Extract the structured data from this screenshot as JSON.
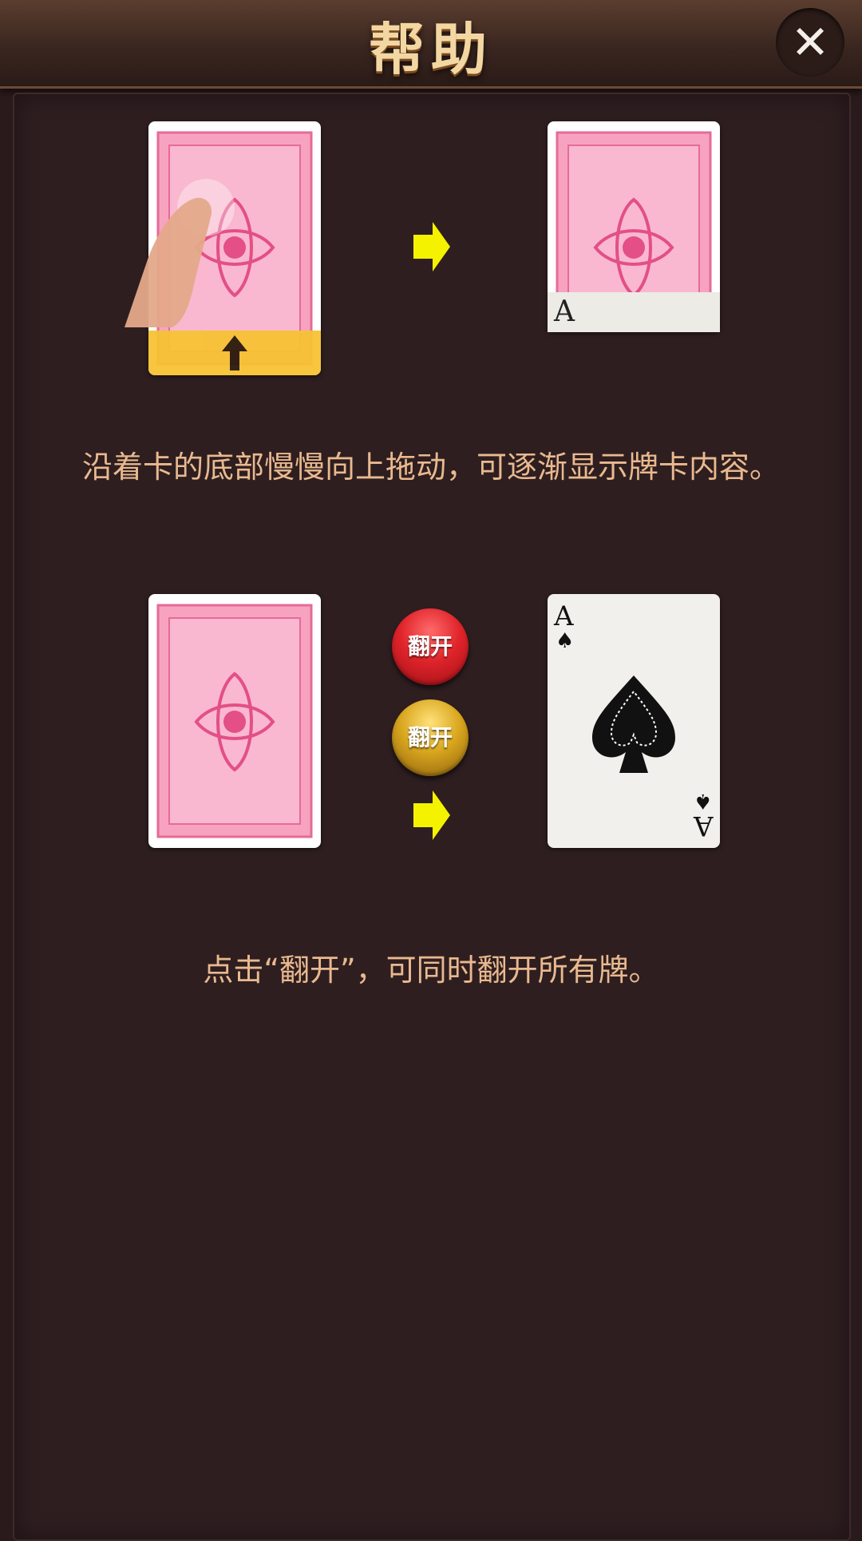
{
  "header": {
    "title": "帮助",
    "close_icon": "close-icon"
  },
  "section1": {
    "caption": "沿着卡的底部慢慢向上拖动，可逐渐显示牌卡内容。",
    "revealed_rank": "A",
    "icons": [
      "card-back-icon",
      "finger-swipe-icon",
      "up-arrow-icon",
      "right-arrow-icon"
    ]
  },
  "section2": {
    "caption": "点击“翻开”，可同时翻开所有牌。",
    "flip_button_red": "翻开",
    "flip_button_gold": "翻开",
    "card_rank": "A",
    "card_suit": "♠"
  },
  "colors": {
    "background": "#2a1a1c",
    "caption_text": "#e9b98f",
    "card_back_pink": "#f08aae",
    "arrow_yellow": "#f5f200",
    "highlight_yellow": "#f7c234"
  }
}
